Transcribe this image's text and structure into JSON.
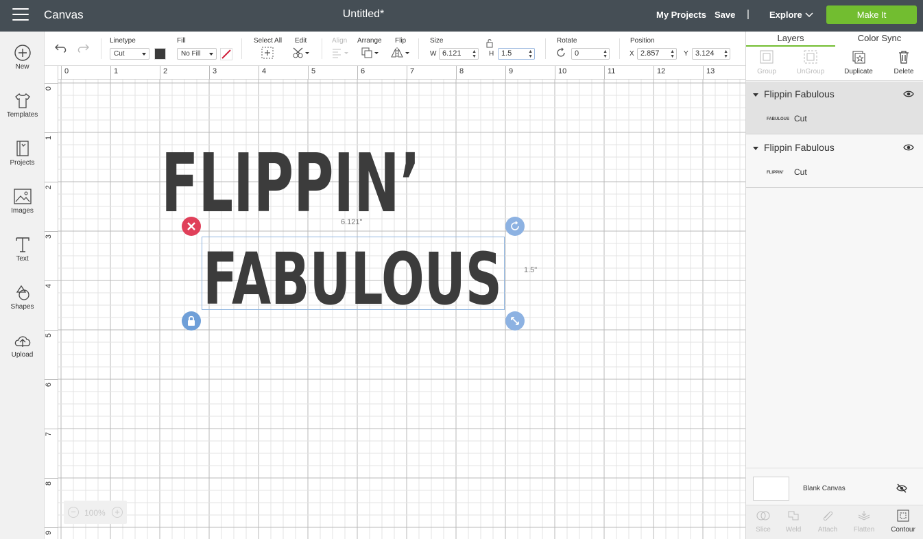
{
  "topbar": {
    "app_title": "Canvas",
    "doc_title": "Untitled*",
    "my_projects": "My Projects",
    "save": "Save",
    "separator": "|",
    "explore": "Explore",
    "make_it": "Make It",
    "make_it_color": "#72bd30",
    "bg_color": "#454e55"
  },
  "sidebar": {
    "items": [
      {
        "label": "New",
        "icon": "plus-circle-icon"
      },
      {
        "label": "Templates",
        "icon": "tshirt-icon"
      },
      {
        "label": "Projects",
        "icon": "notebook-icon"
      },
      {
        "label": "Images",
        "icon": "image-icon"
      },
      {
        "label": "Text",
        "icon": "text-t-icon"
      },
      {
        "label": "Shapes",
        "icon": "shapes-icon"
      },
      {
        "label": "Upload",
        "icon": "cloud-upload-icon"
      }
    ]
  },
  "toolbar": {
    "linetype_label": "Linetype",
    "linetype_value": "Cut",
    "fill_label": "Fill",
    "fill_value": "No Fill",
    "select_all_label": "Select All",
    "edit_label": "Edit",
    "align_label": "Align",
    "arrange_label": "Arrange",
    "flip_label": "Flip",
    "size_label": "Size",
    "w_label": "W",
    "w_value": "6.121",
    "h_label": "H",
    "h_value": "1.5",
    "rotate_label": "Rotate",
    "rotate_value": "0",
    "position_label": "Position",
    "x_label": "X",
    "x_value": "2.857",
    "y_label": "Y",
    "y_value": "3.124",
    "swatch_color": "#3a3a3a"
  },
  "canvas": {
    "ruler_x": [
      "0",
      "1",
      "2",
      "3",
      "4",
      "5",
      "6",
      "7",
      "8",
      "9",
      "10",
      "11",
      "12",
      "13"
    ],
    "ruler_y": [
      "0",
      "1",
      "2",
      "3",
      "4",
      "5",
      "6",
      "7",
      "8",
      "9"
    ],
    "text_line1": "FLIPPIN’",
    "text_line2": "FABULOUS",
    "width_readout": "6.121\"",
    "height_readout": "1.5\"",
    "zoom": "100%",
    "zoom_minus": "−",
    "zoom_plus": "+",
    "delete_handle_color": "#e0405a",
    "handle_color": "#6f9fd8"
  },
  "panel": {
    "tab_layers": "Layers",
    "tab_color_sync": "Color Sync",
    "tools": [
      "Group",
      "UnGroup",
      "Duplicate",
      "Delete"
    ],
    "layers": [
      {
        "name": "Flippin Fabulous",
        "sub": "Cut",
        "thumb": "FABULOUS"
      },
      {
        "name": "Flippin Fabulous",
        "sub": "Cut",
        "thumb": "FLIPPIN’"
      }
    ],
    "blank_canvas": "Blank Canvas",
    "bottom_tools": [
      "Slice",
      "Weld",
      "Attach",
      "Flatten",
      "Contour"
    ]
  }
}
